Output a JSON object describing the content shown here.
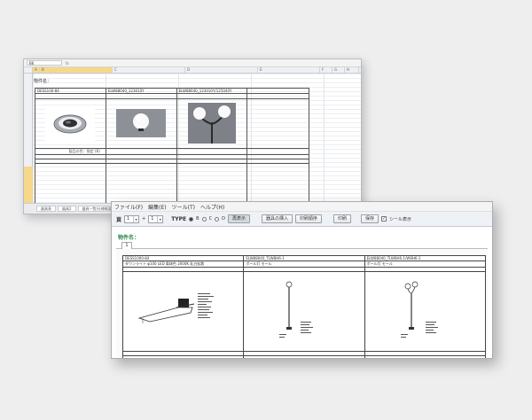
{
  "spreadsheet": {
    "name_box": "B6",
    "fx": "fx",
    "columns": [
      "A",
      "B",
      "C",
      "D",
      "E",
      "F",
      "G",
      "H"
    ],
    "title": "物件名：",
    "header_row": [
      "DESS100-84",
      "ELW88040_123010Y",
      "ELW88040_123010Y/125040Y"
    ],
    "model_note": "製品の色：指定 (B)",
    "products": [
      {
        "name": "recessed-downlight-photo"
      },
      {
        "name": "globe-pendant-photo"
      },
      {
        "name": "twin-globe-pole-photo"
      }
    ],
    "sheet_tabs": [
      "器具表",
      "器具2",
      "器具一覧/仕様概要"
    ]
  },
  "app": {
    "menu": [
      "ファイル(F)",
      "編集(E)",
      "ツール(T)",
      "ヘルプ(H)"
    ],
    "toolbar": {
      "page_label": "頁",
      "page_from": "1",
      "page_plus": "+",
      "page_to": "1",
      "type_label": "TYPE",
      "type_option_b": "B",
      "type_option_c": "C",
      "type_option_d": "D",
      "btn_reload": "再表示",
      "btn_insert": "器具の挿入",
      "btn_print_order": "印刷順序",
      "btn_print": "印刷",
      "btn_save": "保存",
      "check_label": "シール表示",
      "check_mark": "✓"
    },
    "project_label": "物件名：",
    "page_tab": "1",
    "layout_columns": [
      {
        "code": "DESS1000-84",
        "desc": "ダウンライト φ100 LED 電球色 2000K 乳白拡散"
      },
      {
        "code": "ELW88040_TLW8H6-1",
        "desc": "ポール灯 モール"
      },
      {
        "code": "ELW88040_TLW8H6-1/W8H6-1",
        "desc": "ポール灯 モール"
      }
    ]
  },
  "colors": {
    "background": "#eeeeef",
    "selected_header": "#f6d88a",
    "project_label": "#2d8a4a"
  }
}
